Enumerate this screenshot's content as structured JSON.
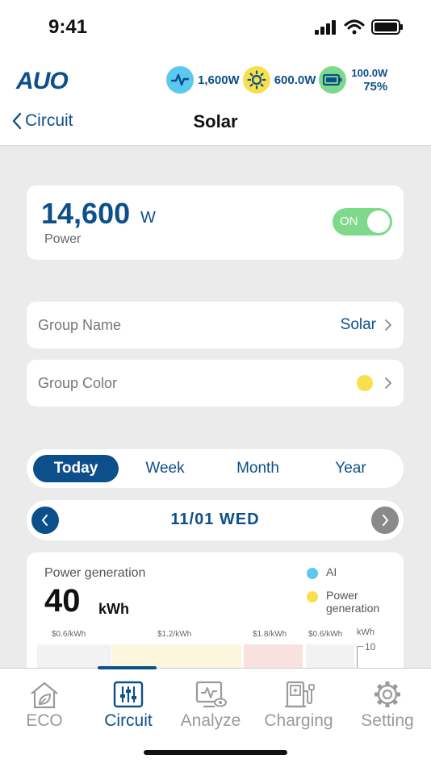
{
  "status_bar": {
    "time": "9:41"
  },
  "header": {
    "logo": "AUO",
    "stats": {
      "grid": "1,600W",
      "solar": "600.0W",
      "battery_power": "100.0W",
      "battery_percent": "75%"
    },
    "back_label": "Circuit",
    "title": "Solar"
  },
  "power_card": {
    "value": "14,600",
    "unit": "W",
    "label": "Power",
    "toggle_label": "ON",
    "toggle_on": true
  },
  "settings": {
    "group_name_label": "Group Name",
    "group_name_value": "Solar",
    "group_color_label": "Group Color",
    "group_color": "#f7e04b"
  },
  "period_tabs": [
    {
      "label": "Today",
      "active": true
    },
    {
      "label": "Week",
      "active": false
    },
    {
      "label": "Month",
      "active": false
    },
    {
      "label": "Year",
      "active": false
    }
  ],
  "date_nav": {
    "date": "11/01 WED"
  },
  "chart": {
    "title": "Power generation",
    "total": "40",
    "unit": "kWh",
    "legend": [
      {
        "label": "AI",
        "color": "#5bc8ef"
      },
      {
        "label": "Power generation",
        "color": "#f7e04b"
      }
    ],
    "prices": [
      "$0.6/kWh",
      "$1.2/kWh",
      "$1.8/kWh",
      "$0.6/kWh"
    ],
    "axis_unit": "kWh",
    "y_top_tick": "10"
  },
  "tabbar": [
    {
      "label": "ECO",
      "icon": "eco-house-icon",
      "active": false
    },
    {
      "label": "Circuit",
      "icon": "circuit-sliders-icon",
      "active": true
    },
    {
      "label": "Analyze",
      "icon": "analyze-monitor-icon",
      "active": false
    },
    {
      "label": "Charging",
      "icon": "charging-station-icon",
      "active": false
    },
    {
      "label": "Setting",
      "icon": "gear-icon",
      "active": false
    }
  ],
  "colors": {
    "brand": "#0d4f8b",
    "toggle_on": "#7fd98a",
    "solar": "#f7e04b",
    "grid": "#5bc8ef",
    "battery": "#7fd98a"
  }
}
